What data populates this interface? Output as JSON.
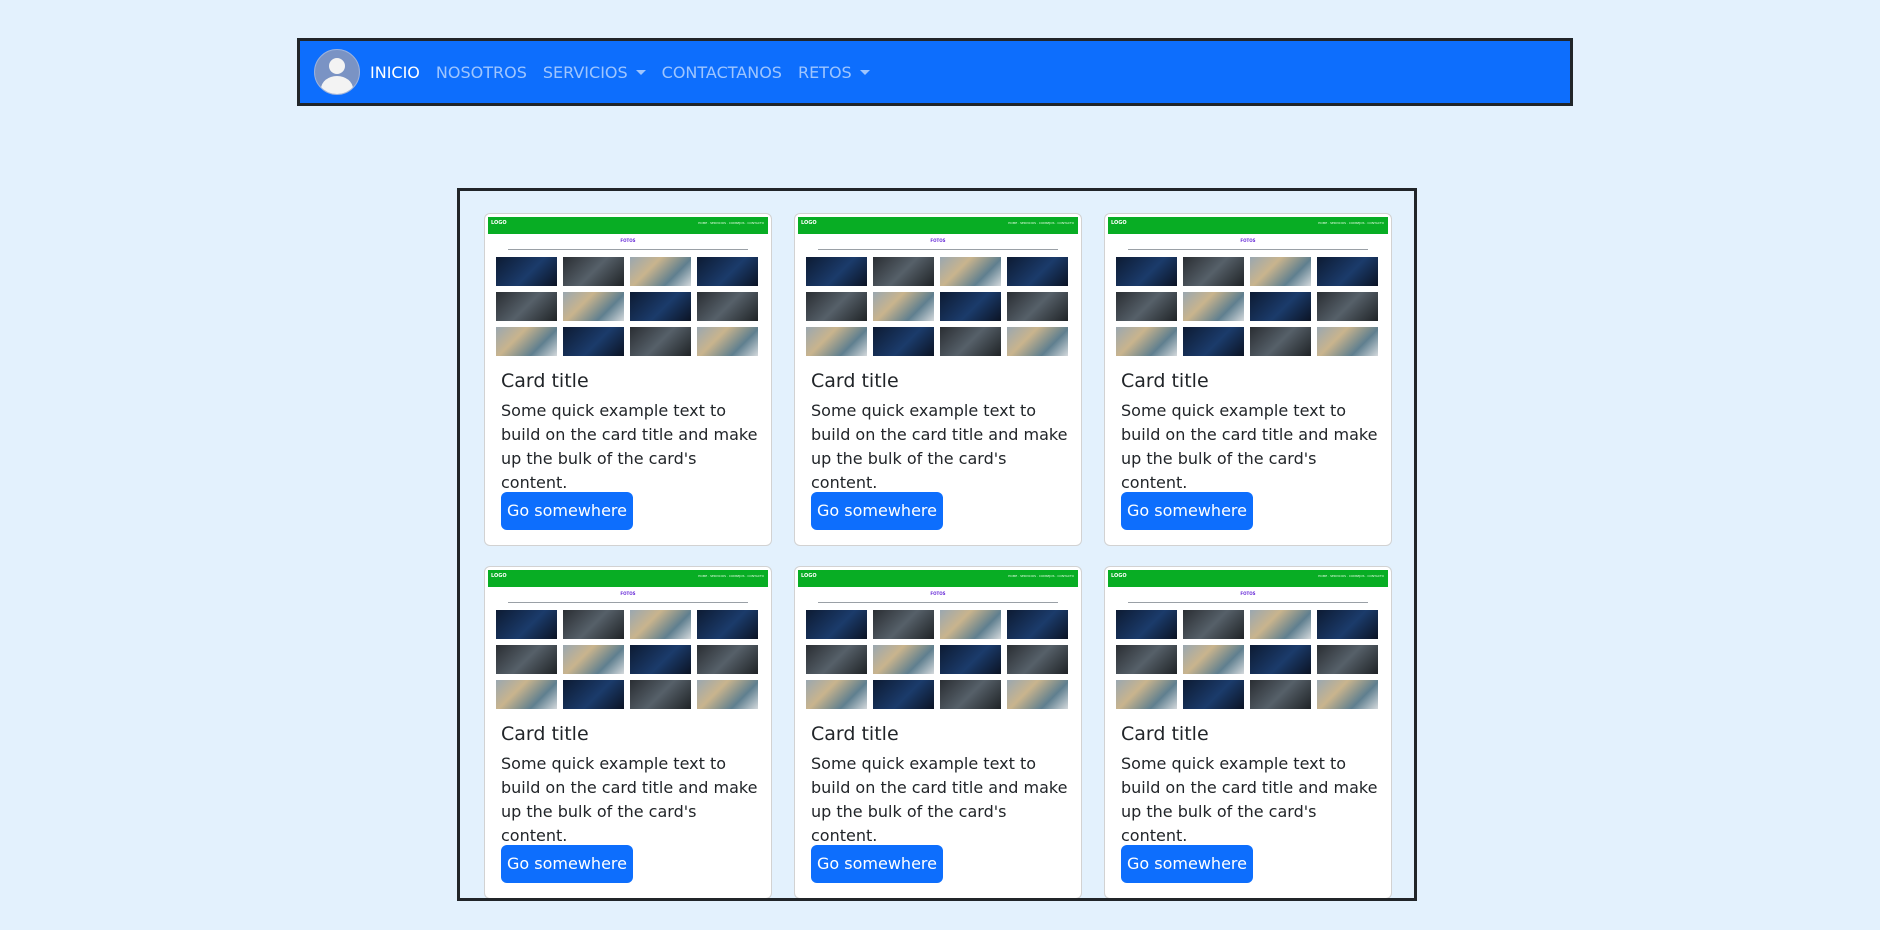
{
  "navbar": {
    "items": [
      {
        "label": "INICIO"
      },
      {
        "label": "NOSOTROS"
      },
      {
        "label": "SERVICIOS"
      },
      {
        "label": "CONTACTANOS"
      },
      {
        "label": "RETOS"
      }
    ]
  },
  "cards": [
    {
      "title": "Card title",
      "text": "Some quick example text to build on the card title and make up the bulk of the card's content.",
      "button": "Go somewhere"
    },
    {
      "title": "Card title",
      "text": "Some quick example text to build on the card title and make up the bulk of the card's content.",
      "button": "Go somewhere"
    },
    {
      "title": "Card title",
      "text": "Some quick example text to build on the card title and make up the bulk of the card's content.",
      "button": "Go somewhere"
    },
    {
      "title": "Card title",
      "text": "Some quick example text to build on the card title and make up the bulk of the card's content.",
      "button": "Go somewhere"
    },
    {
      "title": "Card title",
      "text": "Some quick example text to build on the card title and make up the bulk of the card's content.",
      "button": "Go somewhere"
    },
    {
      "title": "Card title",
      "text": "Some quick example text to build on the card title and make up the bulk of the card's content.",
      "button": "Go somewhere"
    }
  ],
  "thumbnail": {
    "logo": "LOGO",
    "nav": "HOME · SERVICIOS · CONSEJOS · CONTACTO",
    "heading": "FOTOS",
    "tiles": [
      "dark",
      "gray",
      "light",
      "dark",
      "gray",
      "light",
      "dark",
      "gray",
      "light",
      "dark",
      "gray",
      "light"
    ]
  },
  "colors": {
    "navbar": "#0d6efd",
    "thumbnail_bar": "#08ad24",
    "button": "#0d6efd",
    "background": "#e3f1fd"
  }
}
